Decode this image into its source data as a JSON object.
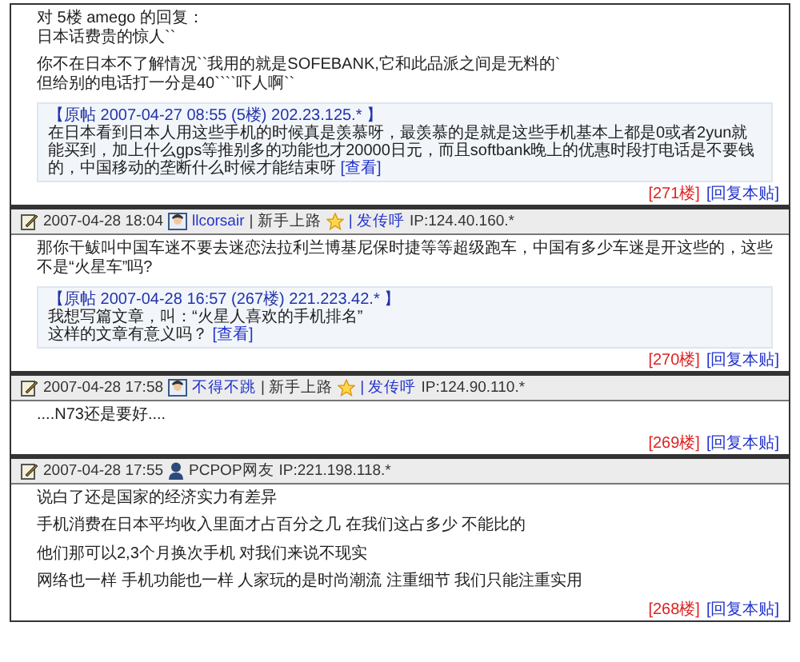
{
  "posts": [
    {
      "body": [
        [
          "对 5楼 amego  的回复：",
          "日本话费贵的惊人``"
        ],
        [
          "你不在日本不了解情况``我用的就是SOFEBANK,它和此品派之间是无料的`",
          "但给别的电话打一分是40````吓人啊``"
        ]
      ],
      "quote": {
        "header": "【原帖 2007-04-27 08:55 (5楼) 202.23.125.* 】",
        "text": "在日本看到日本人用这些手机的时候真是羡慕呀，最羡慕的是就是这些手机基本上都是0或者2yun就能买到，加上什么gps等推别多的功能也才20000日元，而且softbank晚上的优惠时段打电话是不要钱的，中国移动的垄断什么时候才能结束呀",
        "link": "[查看]"
      },
      "footer": {
        "floor": "[271楼]",
        "reply": "[回复本贴]"
      }
    },
    {
      "header": {
        "kind": "member",
        "date": "2007-04-28 18:04",
        "user": "llcorsair",
        "rank": "| 新手上路",
        "page": "| 发传呼",
        "ip": "IP:124.40.160.*"
      },
      "body": [
        [
          "那你干鲅叫中国车迷不要去迷恋法拉利兰博基尼保时捷等等超级跑车，中国有多少车迷是开这些的，这些不是“火星车”吗?"
        ]
      ],
      "quote": {
        "header": "【原帖 2007-04-28 16:57 (267楼) 221.223.42.* 】",
        "text": "我想写篇文章，叫：“火星人喜欢的手机排名”\n这样的文章有意义吗？",
        "link": "[查看]"
      },
      "footer": {
        "floor": "[270楼]",
        "reply": "[回复本贴]"
      }
    },
    {
      "header": {
        "kind": "member",
        "date": "2007-04-28 17:58",
        "user": "不得不跳",
        "rank": "| 新手上路",
        "page": "| 发传呼",
        "ip": "IP:124.90.110.*"
      },
      "body": [
        [
          "....N73还是要好...."
        ]
      ],
      "footer": {
        "floor": "[269楼]",
        "reply": "[回复本贴]"
      }
    },
    {
      "header": {
        "kind": "guest",
        "date": "2007-04-28 17:55",
        "user": "PCPOP网友",
        "ip": "IP:221.198.118.*"
      },
      "body": [
        [
          "说白了还是国家的经济实力有差异"
        ],
        [
          "手机消费在日本平均收入里面才占百分之几 在我们这占多少 不能比的"
        ],
        [
          "他们那可以2,3个月换次手机 对我们来说不现实"
        ],
        [
          "网络也一样 手机功能也一样 人家玩的是时尚潮流 注重细节   我们只能注重实用"
        ]
      ],
      "footer": {
        "floor": "[268楼]",
        "reply": "[回复本贴]"
      }
    }
  ]
}
